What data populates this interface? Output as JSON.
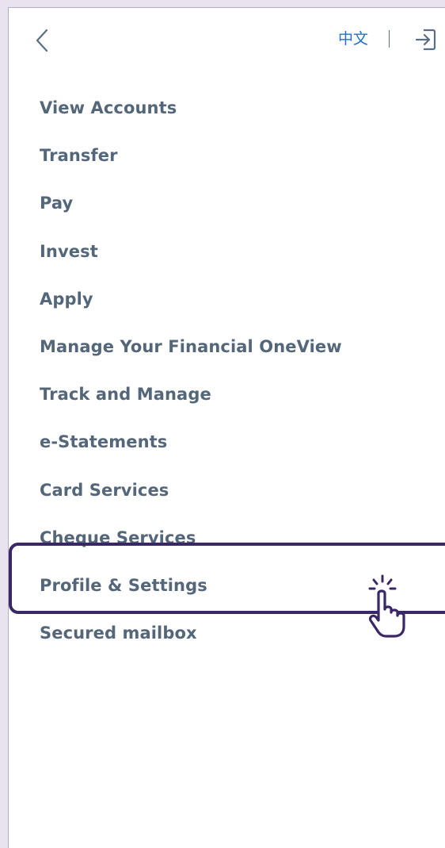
{
  "header": {
    "back_icon": "chevron-left-icon",
    "language_label": "中文",
    "logout_icon": "logout-icon"
  },
  "menu": {
    "items": [
      {
        "label": "View Accounts"
      },
      {
        "label": "Transfer"
      },
      {
        "label": "Pay"
      },
      {
        "label": "Invest"
      },
      {
        "label": "Apply"
      },
      {
        "label": "Manage Your Financial OneView"
      },
      {
        "label": "Track and Manage"
      },
      {
        "label": "e-Statements"
      },
      {
        "label": "Card Services"
      },
      {
        "label": "Cheque Services"
      },
      {
        "label": "Profile & Settings"
      },
      {
        "label": "Secured mailbox"
      }
    ],
    "highlighted_item": "Profile & Settings"
  },
  "colors": {
    "menu_text": "#54677a",
    "link": "#1f6fd1",
    "highlight_border": "#3a2866",
    "background": "#e9e3f0"
  },
  "overlay": {
    "pointer_icon": "hand-pointer-click-icon"
  }
}
